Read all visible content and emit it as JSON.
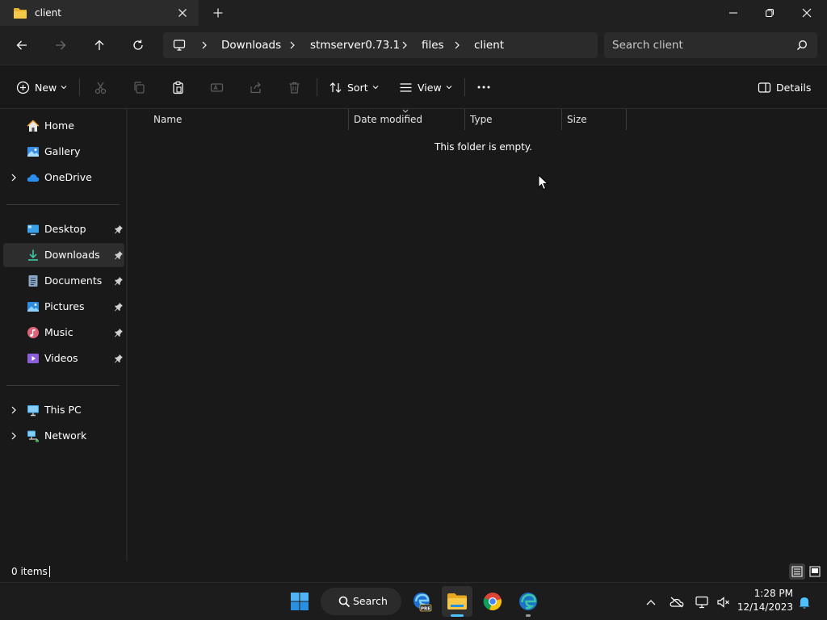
{
  "window": {
    "tab_title": "client"
  },
  "breadcrumb": [
    "Downloads",
    "stmserver0.73.1",
    "files",
    "client"
  ],
  "search": {
    "placeholder": "Search client"
  },
  "toolbar": {
    "new_label": "New",
    "sort_label": "Sort",
    "view_label": "View",
    "details_label": "Details"
  },
  "sidebar": {
    "items": [
      {
        "label": "Home",
        "icon": "home-icon"
      },
      {
        "label": "Gallery",
        "icon": "gallery-icon"
      },
      {
        "label": "OneDrive",
        "icon": "onedrive-icon"
      },
      {
        "label": "Desktop",
        "icon": "desktop-icon"
      },
      {
        "label": "Downloads",
        "icon": "downloads-icon"
      },
      {
        "label": "Documents",
        "icon": "documents-icon"
      },
      {
        "label": "Pictures",
        "icon": "pictures-icon"
      },
      {
        "label": "Music",
        "icon": "music-icon"
      },
      {
        "label": "Videos",
        "icon": "videos-icon"
      },
      {
        "label": "This PC",
        "icon": "this-pc-icon"
      },
      {
        "label": "Network",
        "icon": "network-icon"
      }
    ],
    "selected": "Downloads"
  },
  "columns": [
    "Name",
    "Date modified",
    "Type",
    "Size"
  ],
  "content": {
    "empty_message": "This folder is empty."
  },
  "status": {
    "item_count": "0 items"
  },
  "taskbar": {
    "search_label": "Search",
    "edge_beta_badge": "PRE",
    "time": "1:28 PM",
    "date": "12/14/2023"
  },
  "colors": {
    "accent": "#4cc2ff",
    "folder": "#f5c342",
    "background": "#191919",
    "chrome": "#202020"
  }
}
